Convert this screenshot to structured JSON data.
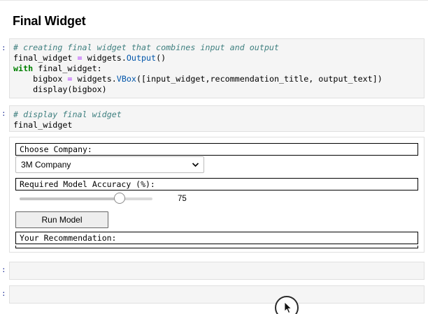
{
  "notebook": {
    "heading": "Final Widget",
    "prompts": [
      ":",
      ":",
      ":",
      ":"
    ]
  },
  "cell1": {
    "comment": "# creating final widget that combines input and output",
    "line2_a": "final_widget ",
    "line2_op": "=",
    "line2_b": " widgets.",
    "line2_fn": "Output",
    "line2_c": "()",
    "line3_kw": "with",
    "line3_b": " final_widget:",
    "line4_a": "    bigbox ",
    "line4_op": "=",
    "line4_b": " widgets.",
    "line4_fn": "VBox",
    "line4_c": "([input_widget,recommendation_title, output_text])",
    "line5": "    display(bigbox)"
  },
  "cell2": {
    "comment": "# display final widget",
    "line2": "final_widget"
  },
  "widget": {
    "company_label": "Choose Company:",
    "company_value": "3M Company",
    "accuracy_label": "Required Model Accuracy (%):",
    "accuracy_value": "75",
    "accuracy_fraction": 0.75,
    "run_button": "Run Model",
    "recommendation_label": "Your Recommendation:"
  },
  "icons": {
    "dropdown": "chevron-down-icon",
    "cursor": "mouse-pointer-icon"
  }
}
